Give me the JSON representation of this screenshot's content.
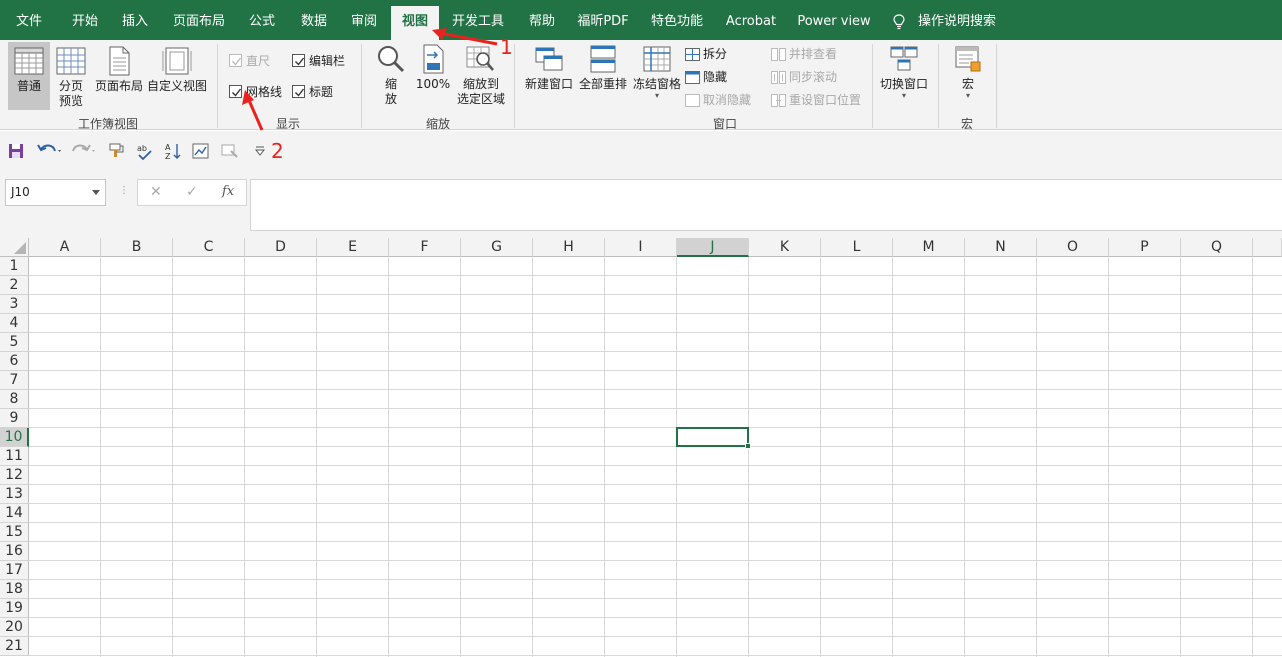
{
  "tabs": [
    "文件",
    "开始",
    "插入",
    "页面布局",
    "公式",
    "数据",
    "审阅",
    "视图",
    "开发工具",
    "帮助",
    "福昕PDF",
    "特色功能",
    "Acrobat",
    "Power view"
  ],
  "active_tab": "视图",
  "search_label": "操作说明搜索",
  "ribbon": {
    "workbook_views": {
      "normal": "普通",
      "page_break_1": "分页",
      "page_break_2": "预览",
      "page_layout": "页面布局",
      "custom_views": "自定义视图",
      "group_label": "工作簿视图"
    },
    "show": {
      "ruler": "直尺",
      "formula_bar": "编辑栏",
      "gridlines": "网格线",
      "headings": "标题",
      "group_label": "显示",
      "ruler_checked": true,
      "formula_bar_checked": true,
      "gridlines_checked": true,
      "headings_checked": true
    },
    "zoom": {
      "zoom_1": "缩",
      "zoom_2": "放",
      "zoom_100": "100%",
      "zoom_sel_1": "缩放到",
      "zoom_sel_2": "选定区域",
      "group_label": "缩放"
    },
    "window": {
      "new_window": "新建窗口",
      "arrange_all": "全部重排",
      "freeze_panes": "冻结窗格",
      "split": "拆分",
      "hide": "隐藏",
      "unhide": "取消隐藏",
      "side_by_side": "并排查看",
      "sync_scroll": "同步滚动",
      "reset_position": "重设窗口位置",
      "switch_windows": "切换窗口",
      "group_label": "窗口"
    },
    "macros": {
      "macros": "宏",
      "group_label": "宏"
    }
  },
  "formula_bar": {
    "name_box": "J10",
    "cancel_glyph": "✕",
    "enter_glyph": "✓",
    "fx_glyph": "fx",
    "value": ""
  },
  "columns": [
    "A",
    "B",
    "C",
    "D",
    "E",
    "F",
    "G",
    "H",
    "I",
    "J",
    "K",
    "L",
    "M",
    "N",
    "O",
    "P",
    "Q"
  ],
  "rows": [
    "1",
    "2",
    "3",
    "4",
    "5",
    "6",
    "7",
    "8",
    "9",
    "10",
    "11",
    "12",
    "13",
    "14",
    "15",
    "16",
    "17",
    "18",
    "19",
    "20",
    "21"
  ],
  "selected_cell": {
    "column": "J",
    "row": "10"
  },
  "annotations": {
    "label_1": "1",
    "label_2": "2",
    "color": "#e8231e"
  },
  "colors": {
    "accent": "#217346",
    "ribbon_bg": "#f3f3f3"
  }
}
